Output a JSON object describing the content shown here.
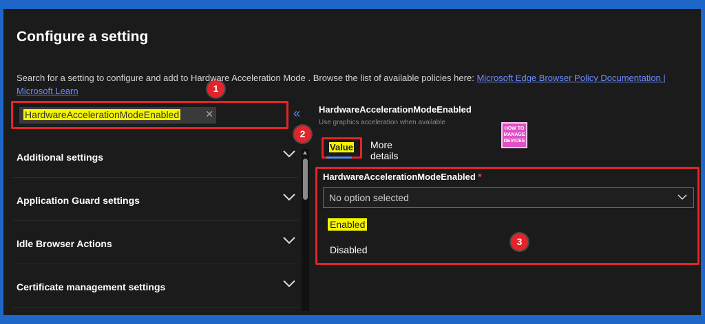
{
  "page": {
    "title": "Configure a setting",
    "description": "Search for a setting to configure and add to Hardware Acceleration Mode . Browse the list of available policies here:",
    "link_text": "Microsoft Edge Browser Policy Documentation | Microsoft Learn"
  },
  "search": {
    "value": "HardwareAccelerationModeEnabled",
    "clear_glyph": "✕"
  },
  "collapse_glyph": "«",
  "categories": [
    {
      "label": "Additional settings"
    },
    {
      "label": "Application Guard settings"
    },
    {
      "label": "Idle Browser Actions"
    },
    {
      "label": "Certificate management settings"
    }
  ],
  "setting": {
    "name": "HardwareAccelerationModeEnabled",
    "description": "Use graphics acceleration when available"
  },
  "tabs": {
    "value": "Value",
    "more": "More details"
  },
  "logo": {
    "line1": "HOW TO",
    "line2": "MANAGE",
    "line3": "DEVICES"
  },
  "field": {
    "label": "HardwareAccelerationModeEnabled",
    "required_mark": "*",
    "placeholder": "No option selected",
    "options": [
      "Enabled",
      "Disabled"
    ]
  },
  "annotations": [
    "1",
    "2",
    "3"
  ],
  "colors": {
    "outer_frame": "#1f66c9",
    "background": "#1b1b1b",
    "highlight_box": "#e3242b",
    "text_highlight": "#f5f500",
    "accent": "#4f8ef7"
  }
}
